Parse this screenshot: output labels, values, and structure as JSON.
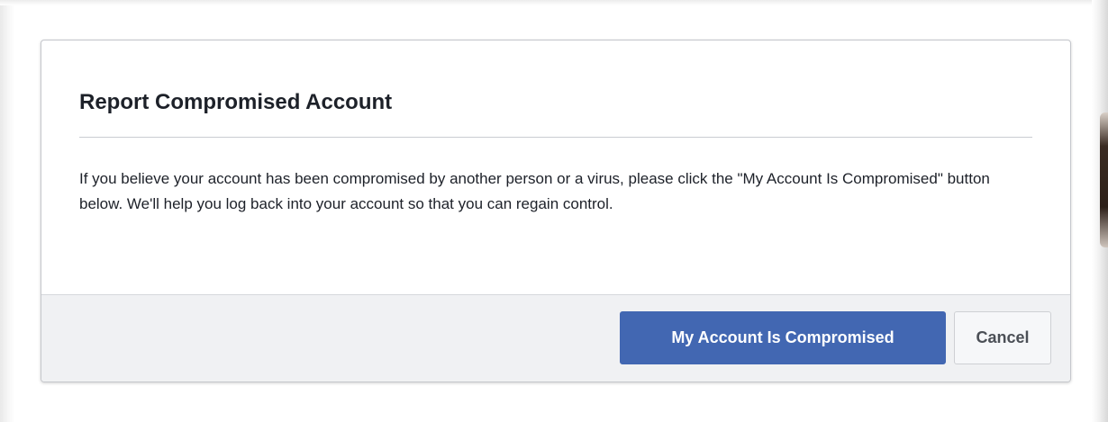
{
  "dialog": {
    "title": "Report Compromised Account",
    "body": "If you believe your account has been compromised by another person or a virus, please click the \"My Account Is Compromised\" button below. We'll help you log back into your account so that you can regain control.",
    "primary_button_label": "My Account Is Compromised",
    "cancel_button_label": "Cancel"
  },
  "colors": {
    "primary_button": "#4267b2",
    "title_text": "#1d2129",
    "footer_background": "#f0f1f3"
  }
}
